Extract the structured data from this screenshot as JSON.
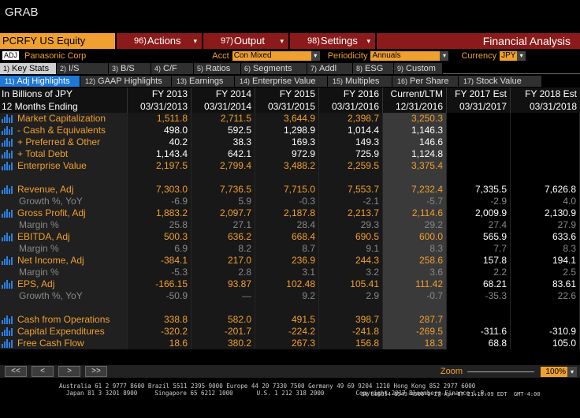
{
  "window_title": "GRAB",
  "toolbar": {
    "ticker": "PCRFY US Equity",
    "menus": [
      {
        "num": "96)",
        "label": "Actions"
      },
      {
        "num": "97)",
        "label": "Output"
      },
      {
        "num": "98)",
        "label": "Settings"
      }
    ],
    "function_title": "Financial Analysis"
  },
  "security_row": {
    "adj_badge": "ADJ",
    "company": "Panasonic Corp",
    "acct_label": "Acct",
    "acct_value": "Con Mixed",
    "periodicity_label": "Periodicity",
    "periodicity_value": "Annuals",
    "currency_label": "Currency",
    "currency_value": "JPY"
  },
  "tabs_primary": [
    {
      "num": "1)",
      "label": "Key Stats",
      "active": true
    },
    {
      "num": "2)",
      "label": "I/S",
      "active": false
    },
    {
      "num": "3)",
      "label": "B/S",
      "active": false
    },
    {
      "num": "4)",
      "label": "C/F",
      "active": false
    },
    {
      "num": "5)",
      "label": "Ratios",
      "active": false
    },
    {
      "num": "6)",
      "label": "Segments",
      "active": false
    },
    {
      "num": "7)",
      "label": "Addl",
      "active": false
    },
    {
      "num": "8)",
      "label": "ESG",
      "active": false
    },
    {
      "num": "9)",
      "label": "Custom",
      "active": false
    }
  ],
  "tabs_secondary": [
    {
      "num": "11)",
      "label": "Adj Highlights",
      "active": true
    },
    {
      "num": "12)",
      "label": "GAAP Highlights",
      "active": false
    },
    {
      "num": "13)",
      "label": "Earnings",
      "active": false
    },
    {
      "num": "14)",
      "label": "Enterprise Value",
      "active": false
    },
    {
      "num": "15)",
      "label": "Multiples",
      "active": false
    },
    {
      "num": "16)",
      "label": "Per Share",
      "active": false
    },
    {
      "num": "17)",
      "label": "Stock Value",
      "active": false
    }
  ],
  "table": {
    "header1": [
      "In Billions of JPY",
      "FY 2013",
      "FY 2014",
      "FY 2015",
      "FY 2016",
      "Current/LTM",
      "FY 2017 Est",
      "FY 2018 Est"
    ],
    "header2": [
      "12 Months Ending",
      "03/31/2013",
      "03/31/2014",
      "03/31/2015",
      "03/31/2016",
      "12/31/2016",
      "03/31/2017",
      "03/31/2018"
    ],
    "rows": [
      {
        "label": "Market Capitalization",
        "icon": true,
        "sub": false,
        "values": [
          "1,511.8",
          "2,711.5",
          "3,644.9",
          "2,398.7",
          "3,250.3",
          "",
          ""
        ],
        "style": "o"
      },
      {
        "label": "- Cash & Equivalents",
        "icon": true,
        "sub": false,
        "values": [
          "498.0",
          "592.5",
          "1,298.9",
          "1,014.4",
          "1,146.3",
          "",
          ""
        ],
        "style": "w"
      },
      {
        "label": "+ Preferred & Other",
        "icon": true,
        "sub": false,
        "values": [
          "40.2",
          "38.3",
          "169.3",
          "149.3",
          "146.6",
          "",
          ""
        ],
        "style": "w"
      },
      {
        "label": "+ Total Debt",
        "icon": true,
        "sub": false,
        "values": [
          "1,143.4",
          "642.1",
          "972.9",
          "725.9",
          "1,124.8",
          "",
          ""
        ],
        "style": "w"
      },
      {
        "label": "Enterprise Value",
        "icon": true,
        "sub": false,
        "values": [
          "2,197.5",
          "2,799.4",
          "3,488.2",
          "2,259.5",
          "3,375.4",
          "",
          ""
        ],
        "style": "o"
      },
      {
        "blank": true
      },
      {
        "label": "Revenue, Adj",
        "icon": true,
        "sub": false,
        "values": [
          "7,303.0",
          "7,736.5",
          "7,715.0",
          "7,553.7",
          "7,232.4",
          "7,335.5",
          "7,626.8"
        ],
        "style": "o",
        "est": "w"
      },
      {
        "label": "Growth %, YoY",
        "icon": false,
        "sub": true,
        "values": [
          "-6.9",
          "5.9",
          "-0.3",
          "-2.1",
          "-5.7",
          "-2.9",
          "4.0"
        ],
        "style": "g"
      },
      {
        "label": "Gross Profit, Adj",
        "icon": true,
        "sub": false,
        "values": [
          "1,883.2",
          "2,097.7",
          "2,187.8",
          "2,213.7",
          "2,114.6",
          "2,009.9",
          "2,130.9"
        ],
        "style": "o",
        "est": "w"
      },
      {
        "label": "Margin %",
        "icon": false,
        "sub": true,
        "values": [
          "25.8",
          "27.1",
          "28.4",
          "29.3",
          "29.2",
          "27.4",
          "27.9"
        ],
        "style": "g"
      },
      {
        "label": "EBITDA, Adj",
        "icon": true,
        "sub": false,
        "values": [
          "500.3",
          "636.2",
          "668.4",
          "690.5",
          "600.0",
          "565.9",
          "633.6"
        ],
        "style": "o",
        "est": "w"
      },
      {
        "label": "Margin %",
        "icon": false,
        "sub": true,
        "values": [
          "6.9",
          "8.2",
          "8.7",
          "9.1",
          "8.3",
          "7.7",
          "8.3"
        ],
        "style": "g"
      },
      {
        "label": "Net Income, Adj",
        "icon": true,
        "sub": false,
        "values": [
          "-384.1",
          "217.0",
          "236.9",
          "244.3",
          "258.6",
          "157.8",
          "194.1"
        ],
        "style": "o",
        "est": "w"
      },
      {
        "label": "Margin %",
        "icon": false,
        "sub": true,
        "values": [
          "-5.3",
          "2.8",
          "3.1",
          "3.2",
          "3.6",
          "2.2",
          "2.5"
        ],
        "style": "g"
      },
      {
        "label": "EPS, Adj",
        "icon": true,
        "sub": false,
        "values": [
          "-166.15",
          "93.87",
          "102.48",
          "105.41",
          "111.42",
          "68.21",
          "83.61"
        ],
        "style": "o",
        "est": "w"
      },
      {
        "label": "Growth %, YoY",
        "icon": false,
        "sub": true,
        "values": [
          "-50.9",
          "—",
          "9.2",
          "2.9",
          "-0.7",
          "-35.3",
          "22.6"
        ],
        "style": "g"
      },
      {
        "blank": true
      },
      {
        "label": "Cash from Operations",
        "icon": true,
        "sub": false,
        "values": [
          "338.8",
          "582.0",
          "491.5",
          "398.7",
          "287.7",
          "",
          ""
        ],
        "style": "o"
      },
      {
        "label": "Capital Expenditures",
        "icon": true,
        "sub": false,
        "values": [
          "-320.2",
          "-201.7",
          "-224.2",
          "-241.8",
          "-269.5",
          "-311.6",
          "-310.9"
        ],
        "style": "o",
        "est": "w"
      },
      {
        "label": "Free Cash Flow",
        "icon": true,
        "sub": false,
        "values": [
          "18.6",
          "380.2",
          "267.3",
          "156.8",
          "18.3",
          "68.8",
          "105.0"
        ],
        "style": "o",
        "est": "w"
      }
    ]
  },
  "nav": {
    "first": "<<",
    "prev": "<",
    "next": ">",
    "last": ">>",
    "zoom_label": "Zoom",
    "zoom_value": "100%"
  },
  "footer": {
    "line1": "Australia 61 2 9777 8600 Brazil 5511 2395 9000 Europe 44 20 7330 7500 Germany 49 69 9204 1210 Hong Kong 852 2977 6000",
    "line2a": "Japan 81 3 3201 8900",
    "line2b": "Singapore 65 6212 1000",
    "line2c": "U.S. 1 212 318 2000",
    "line2d": "Copyright 2017 Bloomberg Finance L.P.",
    "line3": "SN 886894 G549-4566-0 27-Apr-17 21:19:09 EDT  GMT-4:00"
  },
  "colors": {
    "accent": "#f0a030",
    "toolbar": "#8b1a1a",
    "active_tab": "#1e78d8"
  }
}
